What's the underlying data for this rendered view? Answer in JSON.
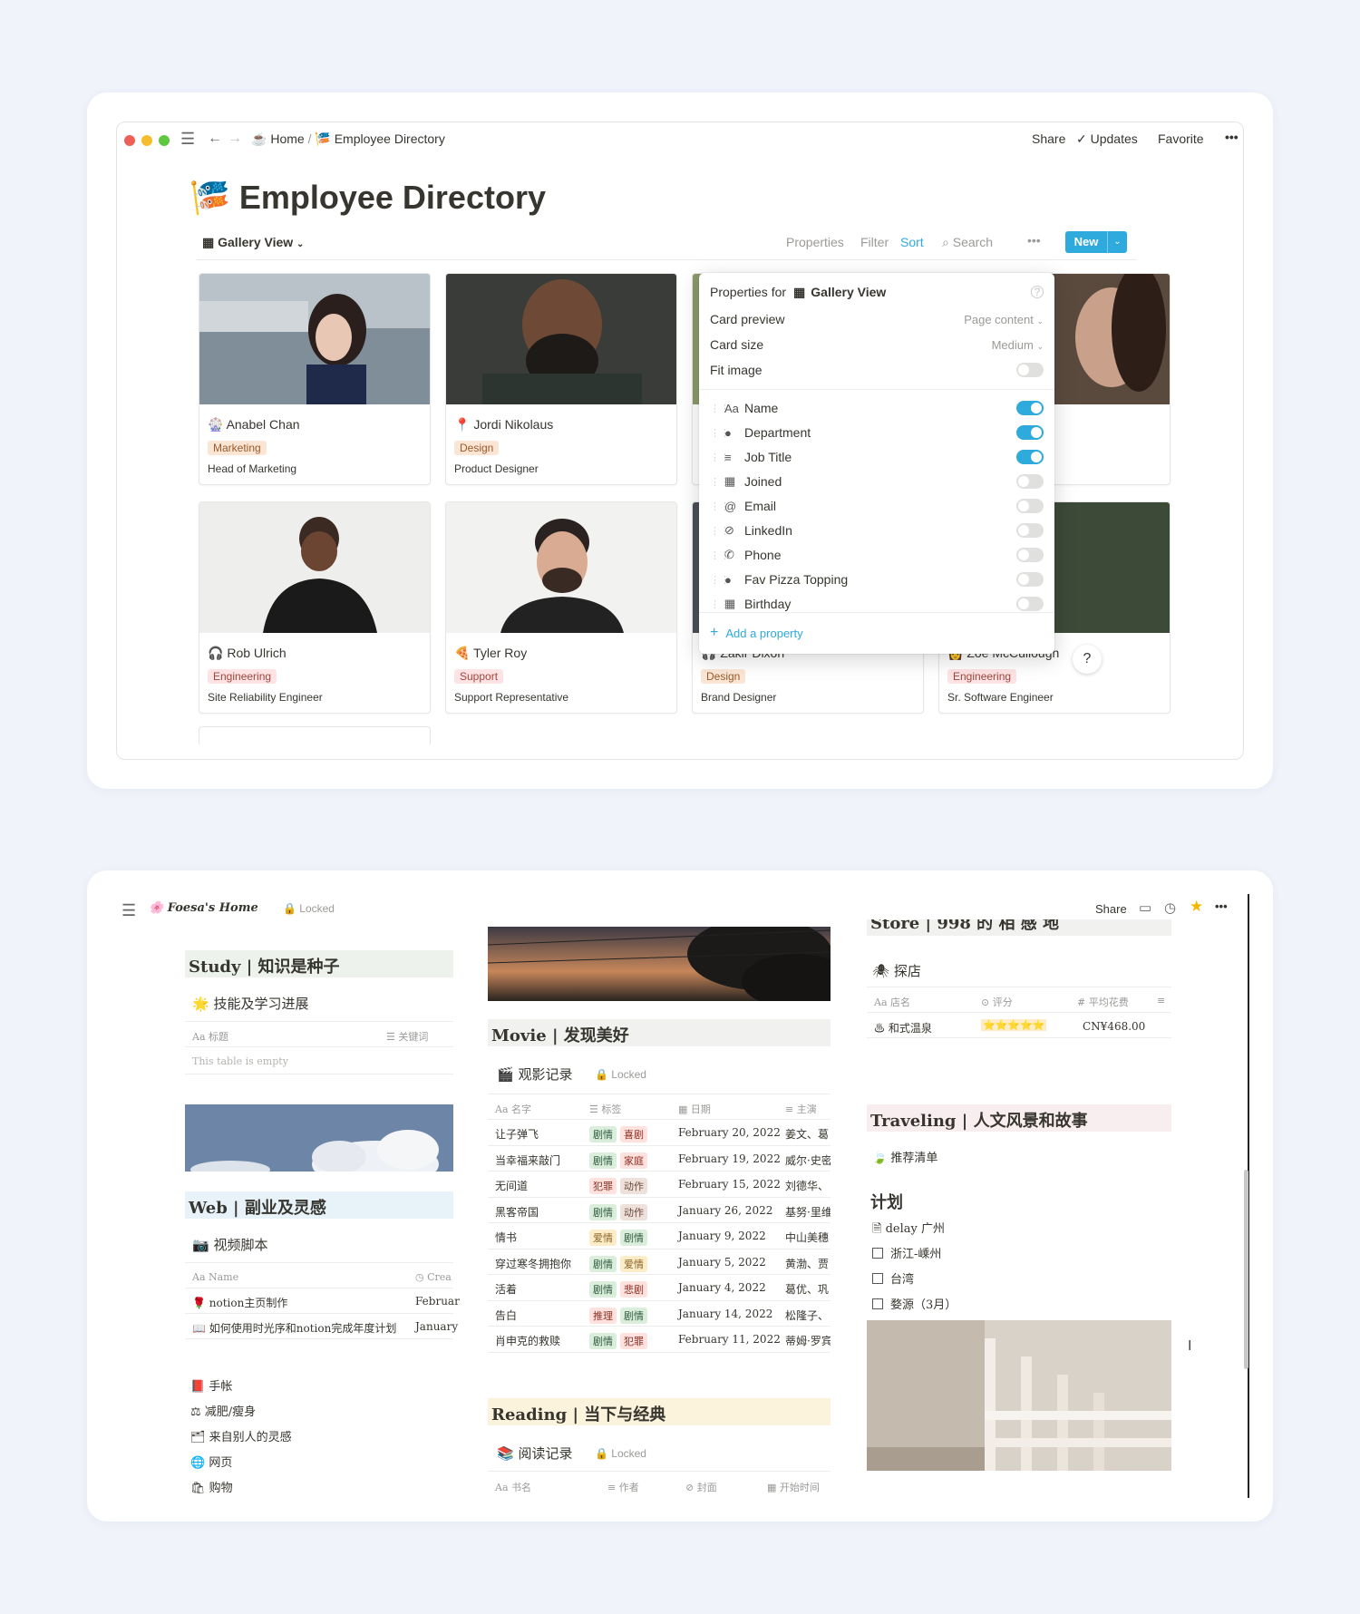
{
  "employee_window": {
    "breadcrumb": {
      "home": "Home",
      "separator": "/",
      "current": "Employee Directory"
    },
    "topbar": {
      "share": "Share",
      "updates": "Updates",
      "favorite": "Favorite",
      "more": "•••"
    },
    "page_title": "Employee Directory",
    "view_label": "Gallery View",
    "toolbar": {
      "properties": "Properties",
      "filter": "Filter",
      "sort": "Sort",
      "search": "Search",
      "more": "•••",
      "new": "New"
    },
    "cards": [
      {
        "name": "Anabel Chan",
        "department": "Marketing",
        "job_title": "Head of Marketing"
      },
      {
        "name": "Jordi Nikolaus",
        "department": "Design",
        "job_title": "Product Designer"
      },
      {
        "name": "Rob Ulrich",
        "department": "Engineering",
        "job_title": "Site Reliability Engineer"
      },
      {
        "name": "Tyler Roy",
        "department": "Support",
        "job_title": "Support Representative"
      },
      {
        "name": "Zakir Dixon",
        "department": "Design",
        "job_title": "Brand Designer"
      },
      {
        "name": "Zoe McCullough",
        "department": "Engineering",
        "job_title": "Sr. Software Engineer"
      }
    ],
    "properties_popup": {
      "header_prefix": "Properties for",
      "header_view": "Gallery View",
      "card_preview_label": "Card preview",
      "card_preview_value": "Page content",
      "card_size_label": "Card size",
      "card_size_value": "Medium",
      "fit_image_label": "Fit image",
      "properties": [
        {
          "label": "Name",
          "icon": "Aa",
          "on": true
        },
        {
          "label": "Department",
          "icon": "●",
          "on": true
        },
        {
          "label": "Job Title",
          "icon": "≡",
          "on": true
        },
        {
          "label": "Joined",
          "icon": "▦",
          "on": false
        },
        {
          "label": "Email",
          "icon": "@",
          "on": false
        },
        {
          "label": "LinkedIn",
          "icon": "⊘",
          "on": false
        },
        {
          "label": "Phone",
          "icon": "✆",
          "on": false
        },
        {
          "label": "Fav Pizza Topping",
          "icon": "●",
          "on": false
        },
        {
          "label": "Birthday",
          "icon": "▦",
          "on": false
        }
      ],
      "add_property": "Add a property"
    },
    "help": "?"
  },
  "home_window": {
    "title": "Foesa's Home",
    "locked": "Locked",
    "topbar": {
      "share": "Share",
      "more": "•••"
    },
    "study": {
      "heading": "Study | 知识是种子",
      "sub": "技能及学习进展",
      "col1": "标题",
      "col2": "关键词",
      "empty": "This table is empty"
    },
    "web": {
      "heading": "Web | 副业及灵感",
      "sub": "视频脚本",
      "col1": "Name",
      "col2": "Crea",
      "rows": [
        {
          "name": "notion主页制作",
          "date": "Februar"
        },
        {
          "name": "如何使用时光序和notion完成年度计划",
          "date": "January"
        }
      ],
      "links": [
        "手帐",
        "减肥/瘦身",
        "来自别人的灵感",
        "网页",
        "购物"
      ]
    },
    "movie": {
      "heading": "Movie | 发现美好",
      "sub": "观影记录",
      "locked": "Locked",
      "cols": [
        "名字",
        "标签",
        "日期",
        "主演"
      ],
      "rows": [
        {
          "name": "让子弹飞",
          "tags": [
            "剧情",
            "喜剧"
          ],
          "date": "February 20, 2022",
          "cast": "姜文、葛"
        },
        {
          "name": "当幸福来敲门",
          "tags": [
            "剧情",
            "家庭"
          ],
          "date": "February 19, 2022",
          "cast": "威尔·史密"
        },
        {
          "name": "无间道",
          "tags": [
            "犯罪",
            "动作"
          ],
          "date": "February 15, 2022",
          "cast": "刘德华、"
        },
        {
          "name": "黑客帝国",
          "tags": [
            "剧情",
            "动作"
          ],
          "date": "January 26, 2022",
          "cast": "基努·里维"
        },
        {
          "name": "情书",
          "tags": [
            "爱情",
            "剧情"
          ],
          "date": "January 9, 2022",
          "cast": "中山美穗"
        },
        {
          "name": "穿过寒冬拥抱你",
          "tags": [
            "剧情",
            "爱情"
          ],
          "date": "January 5, 2022",
          "cast": "黄渤、贾"
        },
        {
          "name": "活着",
          "tags": [
            "剧情",
            "悲剧"
          ],
          "date": "January 4, 2022",
          "cast": "葛优、巩"
        },
        {
          "name": "告白",
          "tags": [
            "推理",
            "剧情"
          ],
          "date": "January 14, 2022",
          "cast": "松隆子、"
        },
        {
          "name": "肖申克的救赎",
          "tags": [
            "剧情",
            "犯罪"
          ],
          "date": "February 11, 2022",
          "cast": "蒂姆·罗宾"
        }
      ]
    },
    "reading": {
      "heading": "Reading | 当下与经典",
      "sub": "阅读记录",
      "locked": "Locked",
      "cols": [
        "书名",
        "作者",
        "封面",
        "开始时间"
      ]
    },
    "store": {
      "heading": "Store | 998 的 相 感 地",
      "sub": "探店",
      "cols": [
        "店名",
        "评分",
        "平均花费"
      ],
      "row": {
        "name": "和式温泉",
        "rating": "⭐⭐⭐⭐⭐",
        "price": "CN¥468.00"
      }
    },
    "traveling": {
      "heading": "Traveling | 人文风景和故事",
      "sub": "推荐清单",
      "plan_title": "计划",
      "plan_items": [
        "delay 广州",
        "浙江-嵊州",
        "台湾",
        "婺源（3月）"
      ]
    }
  },
  "colors": {
    "background": "#f0f3fa",
    "accent": "#2eaadc",
    "new_button": "#2eaadc"
  }
}
